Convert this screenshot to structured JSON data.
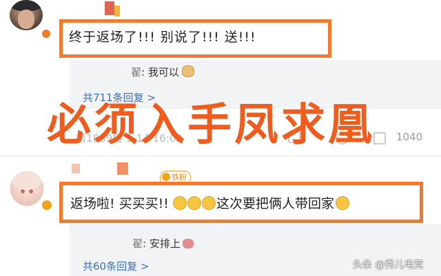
{
  "headline": "必须入手凤求凰",
  "comments": [
    {
      "text": "终于返场了!!! 别说了!!! 送!!!",
      "reply": {
        "name": "翟",
        "text": ": 我可以"
      },
      "reply_count": "共711条回复 >",
      "meta": "第1889楼 1-14 16:02",
      "likes": "1040"
    },
    {
      "fan_badge": "铁粉",
      "text_before": "返场啦! 买买买!! ",
      "text_after": "这次要把俩人带回家",
      "reply": {
        "name": "翟",
        "text": ": 安排上"
      },
      "reply_count": "共60条回复 >"
    }
  ],
  "watermark": "头条 @秀儿电竞",
  "colors": {
    "highlight_border": "#f07a30",
    "headline": "#f05b1e",
    "link": "#3b6fc0"
  }
}
